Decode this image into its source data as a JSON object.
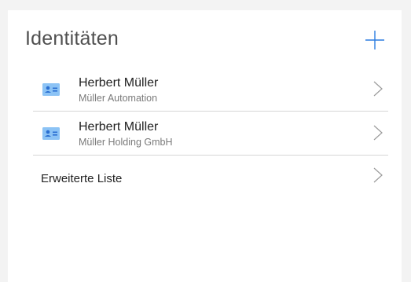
{
  "header": {
    "title": "Identitäten",
    "add_icon": "plus-icon"
  },
  "identities": [
    {
      "name": "Herbert Müller",
      "company": "Müller Automation",
      "icon": "contact-card-icon"
    },
    {
      "name": "Herbert Müller",
      "company": "Müller Holding GmbH",
      "icon": "contact-card-icon"
    }
  ],
  "extended_list": {
    "label": "Erweiterte Liste"
  },
  "colors": {
    "accent": "#2b7ce0",
    "card_icon_bg": "#8cc3f5",
    "card_icon_fg": "#2a6fd1",
    "divider": "#d6d6d6",
    "chevron": "#9a9a9a"
  }
}
